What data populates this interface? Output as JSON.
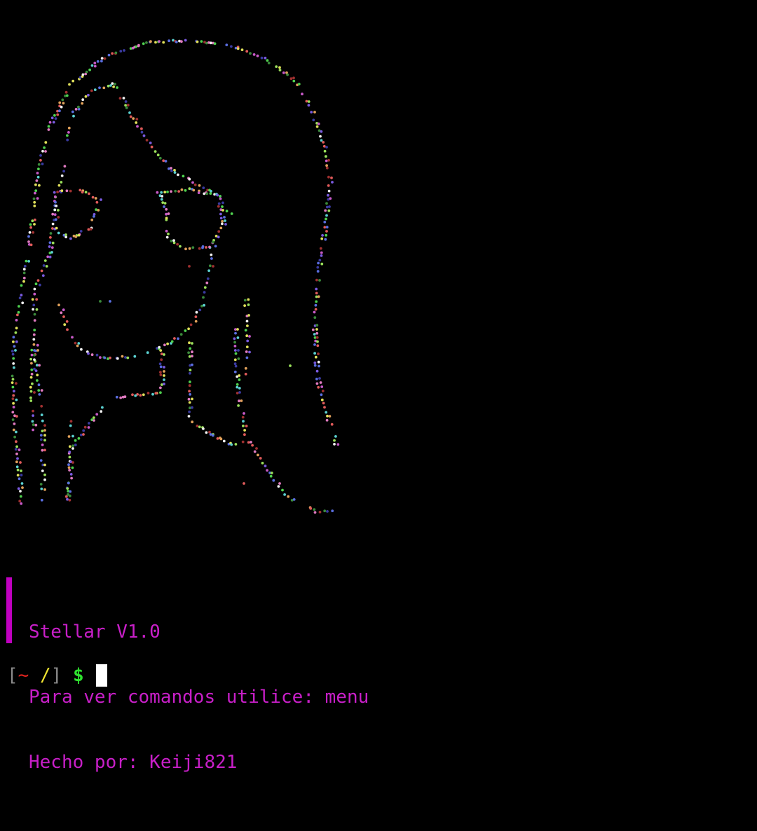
{
  "terminal": {
    "background": "#000000",
    "art": {
      "style": "colored braille dot ASCII-art portrait",
      "palette": [
        "#e05a5a",
        "#4fd14f",
        "#5a6ee0",
        "#c85ac8",
        "#e0e05a",
        "#5ad0d0",
        "#e0a05a",
        "#f0f0f0",
        "#a03030",
        "#3a8a3a",
        "#3a3aa0",
        "#e07ac0",
        "#9ae05a",
        "#7a5ae0"
      ]
    },
    "banner": {
      "accent_color": "#c000c0",
      "lines": [
        "Stellar V1.0",
        "Para ver comandos utilice: menu",
        "Hecho por: Keiji821"
      ]
    },
    "prompt": {
      "open_bracket": "[",
      "tilde": "~",
      "space": " ",
      "slash": "/",
      "close_bracket": "]",
      "dollar": "$",
      "colors": {
        "bracket": "#8a8a8a",
        "tilde": "#e0241f",
        "slash": "#f2e530",
        "dollar": "#2fe32f"
      }
    }
  }
}
